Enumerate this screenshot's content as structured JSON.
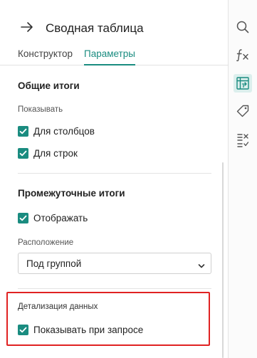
{
  "header": {
    "title": "Сводная таблица",
    "tabs": [
      {
        "label": "Конструктор",
        "active": false
      },
      {
        "label": "Параметры",
        "active": true
      }
    ]
  },
  "totals": {
    "title": "Общие итоги",
    "show_label": "Показывать",
    "options": [
      {
        "label": "Для столбцов",
        "checked": true
      },
      {
        "label": "Для строк",
        "checked": true
      }
    ]
  },
  "subtotals": {
    "title": "Промежуточные итоги",
    "display_option": {
      "label": "Отображать",
      "checked": true
    },
    "position_label": "Расположение",
    "position_value": "Под группой"
  },
  "drilldown": {
    "title": "Детализация данных",
    "option": {
      "label": "Показывать при запросе",
      "checked": true
    }
  },
  "rail": {
    "icons": [
      "search-icon",
      "function-icon",
      "pivot-table-icon",
      "tag-icon",
      "checklist-icon"
    ],
    "active": "pivot-table-icon"
  },
  "colors": {
    "accent": "#1a8c80",
    "highlight_border": "#e02222"
  }
}
